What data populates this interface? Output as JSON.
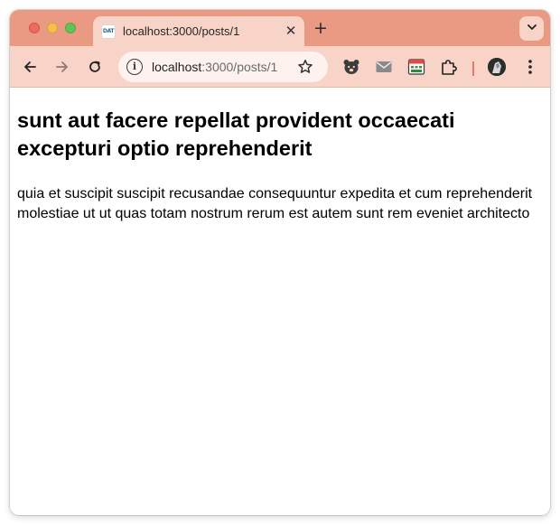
{
  "browser": {
    "tab": {
      "favicon_text": "DAT",
      "title": "localhost:3000/posts/1"
    },
    "omnibox": {
      "host": "localhost",
      "path": ":3000/posts/1"
    },
    "colors": {
      "tabstrip": "#ea9a83",
      "toolbar": "#f8d3c8"
    },
    "icons": [
      "close-icon",
      "new-tab-icon",
      "tab-search-icon",
      "back-icon",
      "forward-icon",
      "reload-icon",
      "site-info-icon",
      "bookmark-star-icon",
      "bear-extension-icon",
      "mail-extension-icon",
      "calendar-extension-icon",
      "extensions-puzzle-icon",
      "profile-avatar-icon",
      "menu-icon"
    ]
  },
  "page": {
    "title": "sunt aut facere repellat provident occaecati excepturi optio reprehenderit",
    "body": "quia et suscipit suscipit recusandae consequuntur expedita et cum reprehenderit molestiae ut ut quas totam nostrum rerum est autem sunt rem eveniet architecto"
  }
}
